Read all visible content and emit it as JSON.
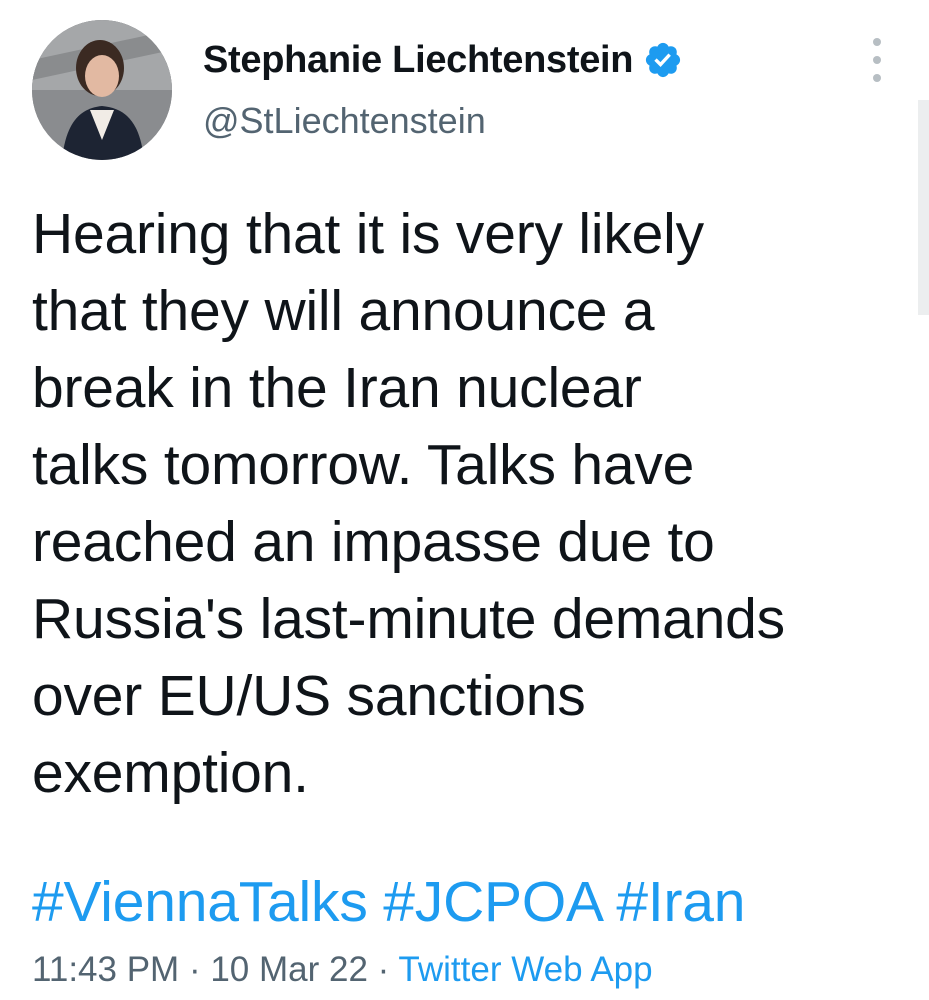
{
  "tweet": {
    "author": {
      "display_name": "Stephanie Liechtenstein",
      "handle": "@StLiechtenstein",
      "verified": true
    },
    "text_lines": [
      "Hearing that it is very likely",
      "that they will announce a",
      "break in the Iran nuclear",
      "talks tomorrow. Talks have",
      "reached an impasse due to",
      "Russia's last-minute demands",
      "over EU/US sanctions",
      "exemption."
    ],
    "hashtags": [
      "#ViennaTalks",
      "#JCPOA",
      "#Iran"
    ],
    "time": "11:43 PM",
    "date": "10 Mar 22",
    "separator": "·",
    "source": "Twitter Web App"
  },
  "colors": {
    "link": "#1d9bf0",
    "text": "#0f1419",
    "secondary": "#536471"
  },
  "icons": {
    "verified": "verified-badge-icon",
    "more": "more-vertical-icon"
  }
}
